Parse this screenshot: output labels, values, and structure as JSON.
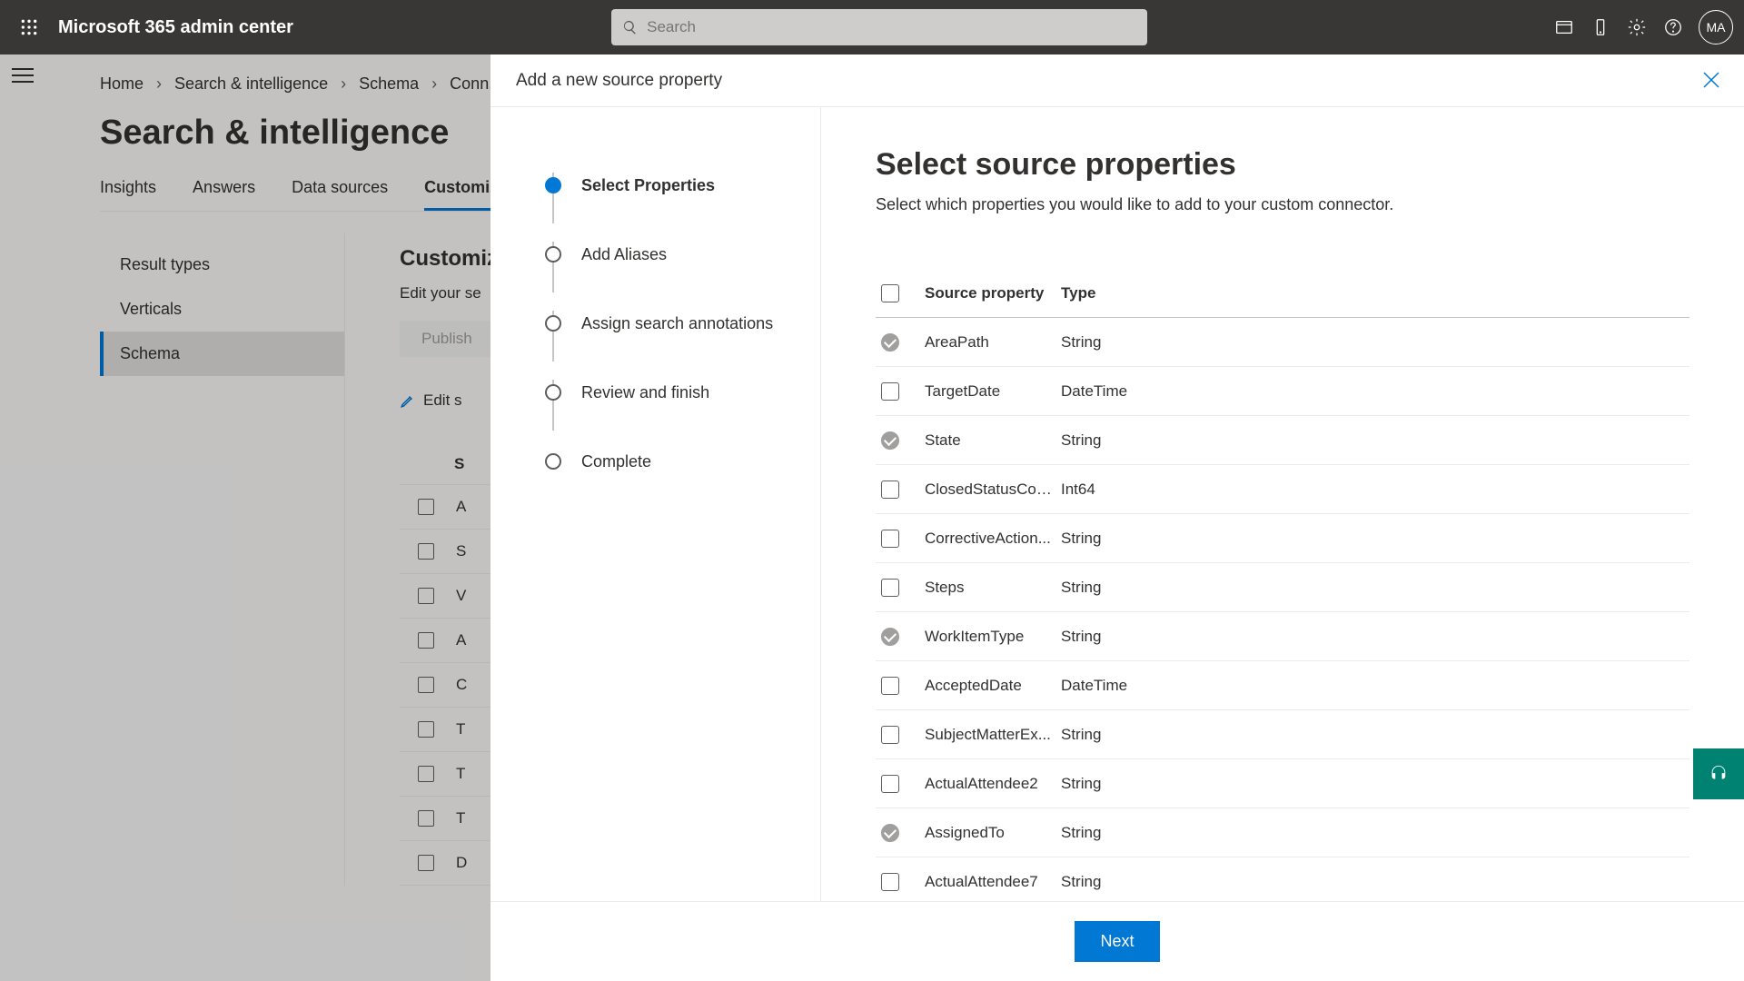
{
  "header": {
    "app_title": "Microsoft 365 admin center",
    "search_placeholder": "Search",
    "avatar_initials": "MA"
  },
  "breadcrumb": [
    "Home",
    "Search & intelligence",
    "Schema",
    "Conn..."
  ],
  "page_title": "Search & intelligence",
  "tabs": {
    "items": [
      "Insights",
      "Answers",
      "Data sources",
      "Customiz"
    ],
    "active_index": 3
  },
  "leftnav": {
    "items": [
      "Result types",
      "Verticals",
      "Schema"
    ],
    "selected_index": 2
  },
  "rightpane": {
    "heading": "Customiz",
    "subtitle": "Edit your se",
    "publish_label": "Publish",
    "edit_link": "Edit s",
    "bg_header": "S",
    "bg_rows": [
      "A",
      "S",
      "V",
      "A",
      "C",
      "T",
      "T",
      "T",
      "D"
    ]
  },
  "panel": {
    "title": "Add a new source property",
    "steps": [
      "Select Properties",
      "Add Aliases",
      "Assign search annotations",
      "Review and finish",
      "Complete"
    ],
    "active_step": 0,
    "form_title": "Select source properties",
    "form_subtitle": "Select which properties you would like to add to your custom connector.",
    "table_header": {
      "col1": "Source property",
      "col2": "Type"
    },
    "rows": [
      {
        "name": "AreaPath",
        "type": "String",
        "preselected": true
      },
      {
        "name": "TargetDate",
        "type": "DateTime",
        "preselected": false
      },
      {
        "name": "State",
        "type": "String",
        "preselected": true
      },
      {
        "name": "ClosedStatusCode",
        "type": "Int64",
        "preselected": false
      },
      {
        "name": "CorrectiveAction...",
        "type": "String",
        "preselected": false
      },
      {
        "name": "Steps",
        "type": "String",
        "preselected": false
      },
      {
        "name": "WorkItemType",
        "type": "String",
        "preselected": true
      },
      {
        "name": "AcceptedDate",
        "type": "DateTime",
        "preselected": false
      },
      {
        "name": "SubjectMatterEx...",
        "type": "String",
        "preselected": false
      },
      {
        "name": "ActualAttendee2",
        "type": "String",
        "preselected": false
      },
      {
        "name": "AssignedTo",
        "type": "String",
        "preselected": true
      },
      {
        "name": "ActualAttendee7",
        "type": "String",
        "preselected": false
      }
    ],
    "next_label": "Next"
  }
}
